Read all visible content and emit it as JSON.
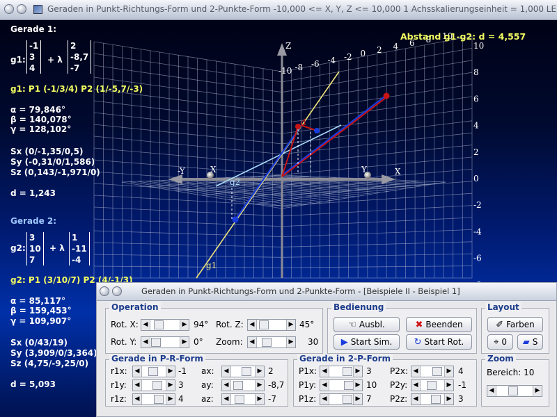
{
  "window": {
    "title": "Geraden in Punkt-Richtungs-Form und 2-Punkte-Form   -10,000 <= X, Y, Z <= 10,000   1 Achsskalierungseinheit = 1,000 LE"
  },
  "left_panel": {
    "g1_header": "Gerade 1:",
    "g1_label": "g1:",
    "g1_p": [
      "-1",
      "3",
      "4"
    ],
    "g1_lambda": "+ λ",
    "g1_v": [
      "2",
      "-8,7",
      "-7"
    ],
    "g1_points": "g1:  P1 (-1/3/4)    P2 (1/-5,7/-3)",
    "g1_alpha": "α = 79,846°",
    "g1_beta": "β = 140,078°",
    "g1_gamma": "γ = 128,102°",
    "g1_sx": "Sx (0/-1,35/0,5)",
    "g1_sy": "Sy (-0,31/0/1,586)",
    "g1_sz": "Sz (0,143/-1,971/0)",
    "g1_d": "d = 1,243",
    "g2_header": "Gerade 2:",
    "g2_label": "g2:",
    "g2_p": [
      "3",
      "10",
      "7"
    ],
    "g2_lambda": "+ λ",
    "g2_v": [
      "1",
      "-11",
      "-4"
    ],
    "g2_points": "g2:  P1 (3/10/7)     P2 (4/-1/3)",
    "g2_alpha": "α = 85,117°",
    "g2_beta": "β = 159,453°",
    "g2_gamma": "γ = 109,907°",
    "g2_sx": "Sx (0/43/19)",
    "g2_sy": "Sy (3,909/0/3,364)",
    "g2_sz": "Sz (4,75/-9,25/0)",
    "g2_d": "d = 5,093"
  },
  "plot": {
    "abstand": "Abstand g1-g2: d = 4,557",
    "axis_z": "Z",
    "axis_x_pos": "X",
    "axis_x_neg": "X",
    "axis_y_pos": "Y",
    "axis_y_neg": "-Y",
    "line_labels": [
      "g1",
      "g2",
      "d"
    ],
    "right_ticks": [
      "10",
      "8",
      "6",
      "4",
      "2",
      "0",
      "-2",
      "-4",
      "-6",
      "-8"
    ],
    "top_ticks": [
      "-10",
      "-8",
      "-6",
      "-4",
      "-2",
      "0",
      "2",
      "4",
      "6",
      "8",
      "10"
    ],
    "colors": {
      "g1": "#f0e67a",
      "g2": "#a8d8f8",
      "blue": "#1a3cdc",
      "red": "#c81414",
      "grid": "#b4bcd4"
    }
  },
  "subwindow": {
    "title": "Geraden in Punkt-Richtungs-Form und 2-Punkte-Form - [Beispiele II - Beispiel 1]",
    "operation": {
      "label": "Operation",
      "rot_x_label": "Rot. X:",
      "rot_x_value": "94°",
      "rot_y_label": "Rot. Y:",
      "rot_y_value": "0°",
      "rot_z_label": "Rot. Z:",
      "rot_z_value": "45°",
      "zoom_label": "Zoom:",
      "zoom_value": "30"
    },
    "bedienung": {
      "label": "Bedienung",
      "ausbl": "Ausbl.",
      "beenden": "Beenden",
      "start_sim": "Start Sim.",
      "start_rot": "Start Rot."
    },
    "layout": {
      "label": "Layout",
      "farben": "Farben",
      "zero": "0",
      "s": "S"
    },
    "pr_form": {
      "label": "Gerade in P-R-Form",
      "rows": [
        {
          "l1": "r1x:",
          "v1": "-1",
          "l2": "ax:",
          "v2": "2"
        },
        {
          "l1": "r1y:",
          "v1": "3",
          "l2": "ay:",
          "v2": "-8,7"
        },
        {
          "l1": "r1z:",
          "v1": "4",
          "l2": "az:",
          "v2": "-7"
        }
      ]
    },
    "pp_form": {
      "label": "Gerade in 2-P-Form",
      "rows": [
        {
          "l1": "P1x:",
          "v1": "3",
          "l2": "P2x:",
          "v2": "4"
        },
        {
          "l1": "P1y:",
          "v1": "10",
          "l2": "P2y:",
          "v2": "-1"
        },
        {
          "l1": "P1z:",
          "v1": "7",
          "l2": "P2z:",
          "v2": "3"
        }
      ]
    },
    "zoom": {
      "label": "Zoom",
      "bereich": "Bereich:  10"
    }
  }
}
